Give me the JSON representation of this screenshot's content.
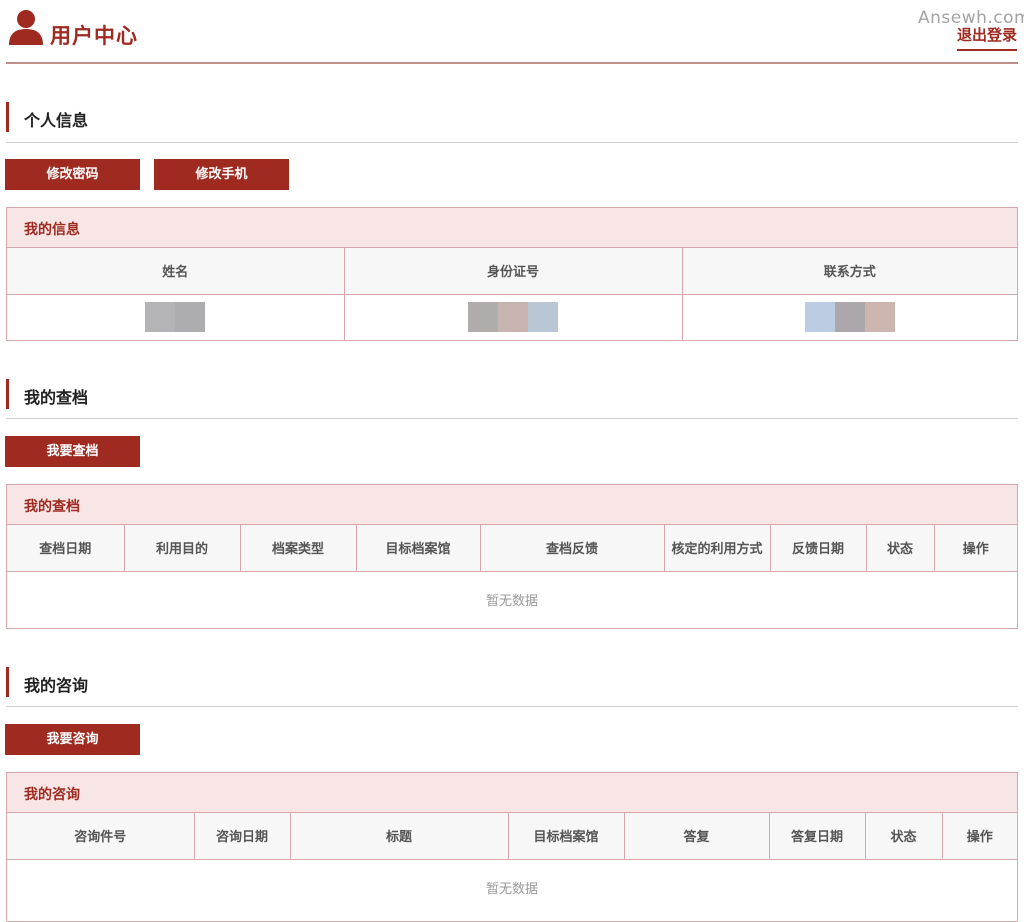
{
  "header": {
    "title": "用户中心",
    "watermark": "Ansewh.com",
    "logout": "退出登录"
  },
  "personal": {
    "title": "个人信息",
    "buttons": [
      "修改密码",
      "修改手机"
    ],
    "panel_title": "我的信息",
    "columns": [
      "姓名",
      "身份证号",
      "联系方式"
    ]
  },
  "archive": {
    "title": "我的查档",
    "button": "我要查档",
    "panel_title": "我的查档",
    "columns": [
      "查档日期",
      "利用目的",
      "档案类型",
      "目标档案馆",
      "查档反馈",
      "核定的利用方式",
      "反馈日期",
      "状态",
      "操作"
    ],
    "empty": "暂无数据"
  },
  "consult": {
    "title": "我的咨询",
    "button": "我要咨询",
    "panel_title": "我的咨询",
    "columns": [
      "咨询件号",
      "咨询日期",
      "标题",
      "目标档案馆",
      "答复",
      "答复日期",
      "状态",
      "操作"
    ],
    "empty": "暂无数据"
  },
  "colors": {
    "accent": "#9e2a20",
    "panel_header_bg": "#f8e6e7",
    "border": "#d6a7ad"
  }
}
